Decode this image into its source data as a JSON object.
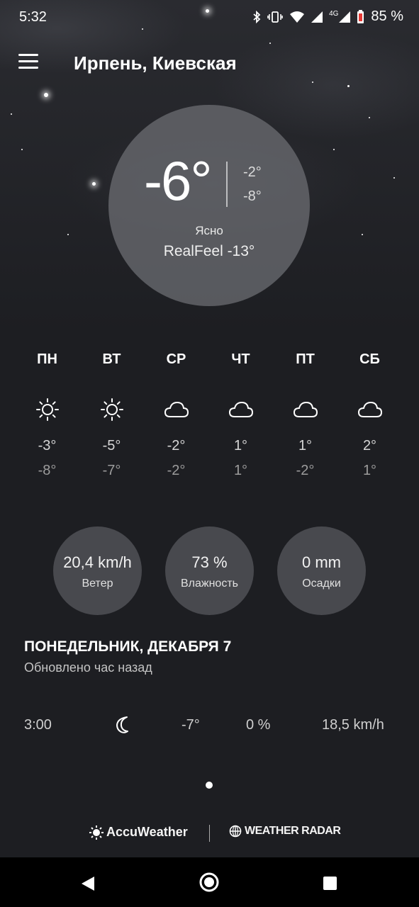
{
  "status_bar": {
    "time": "5:32",
    "network": "4G",
    "battery": "85 %",
    "icons": [
      "bluetooth-icon",
      "vibrate-icon",
      "wifi-icon",
      "signal-icon",
      "signal-4g-icon",
      "battery-icon"
    ]
  },
  "header": {
    "menu_icon": "hamburger-menu-icon",
    "city": "Ирпень, Киевская"
  },
  "current": {
    "temp": "-6°",
    "high": "-2°",
    "low": "-8°",
    "condition": "Ясно",
    "realfeel": "RealFeel -13°"
  },
  "forecast": [
    {
      "day": "ПН",
      "icon": "sun-icon",
      "high": "-3°",
      "low": "-8°"
    },
    {
      "day": "ВТ",
      "icon": "sun-icon",
      "high": "-5°",
      "low": "-7°"
    },
    {
      "day": "СР",
      "icon": "cloud-icon",
      "high": "-2°",
      "low": "-2°"
    },
    {
      "day": "ЧТ",
      "icon": "cloud-icon",
      "high": "1°",
      "low": "1°"
    },
    {
      "day": "ПТ",
      "icon": "cloud-icon",
      "high": "1°",
      "low": "-2°"
    },
    {
      "day": "СБ",
      "icon": "cloud-icon",
      "high": "2°",
      "low": "1°"
    }
  ],
  "stats": {
    "wind": {
      "value": "20,4 km/h",
      "label": "Ветер"
    },
    "humidity": {
      "value": "73 %",
      "label": "Влажность"
    },
    "precip": {
      "value": "0 mm",
      "label": "Осадки"
    }
  },
  "day_detail": {
    "title": "ПОНЕДЕЛЬНИК, ДЕКАБРЯ 7",
    "updated": "Обновлено час назад"
  },
  "hourly": [
    {
      "time": "3:00",
      "icon": "moon-icon",
      "temp": "-7°",
      "precip": "0 %",
      "wind": "18,5 km/h"
    }
  ],
  "branding": {
    "accuweather": "AccuWeather",
    "radar": "WEATHER RADAR"
  },
  "colors": {
    "background": "#1d1e22",
    "circle": "#696a70",
    "bubble": "#48494e"
  }
}
